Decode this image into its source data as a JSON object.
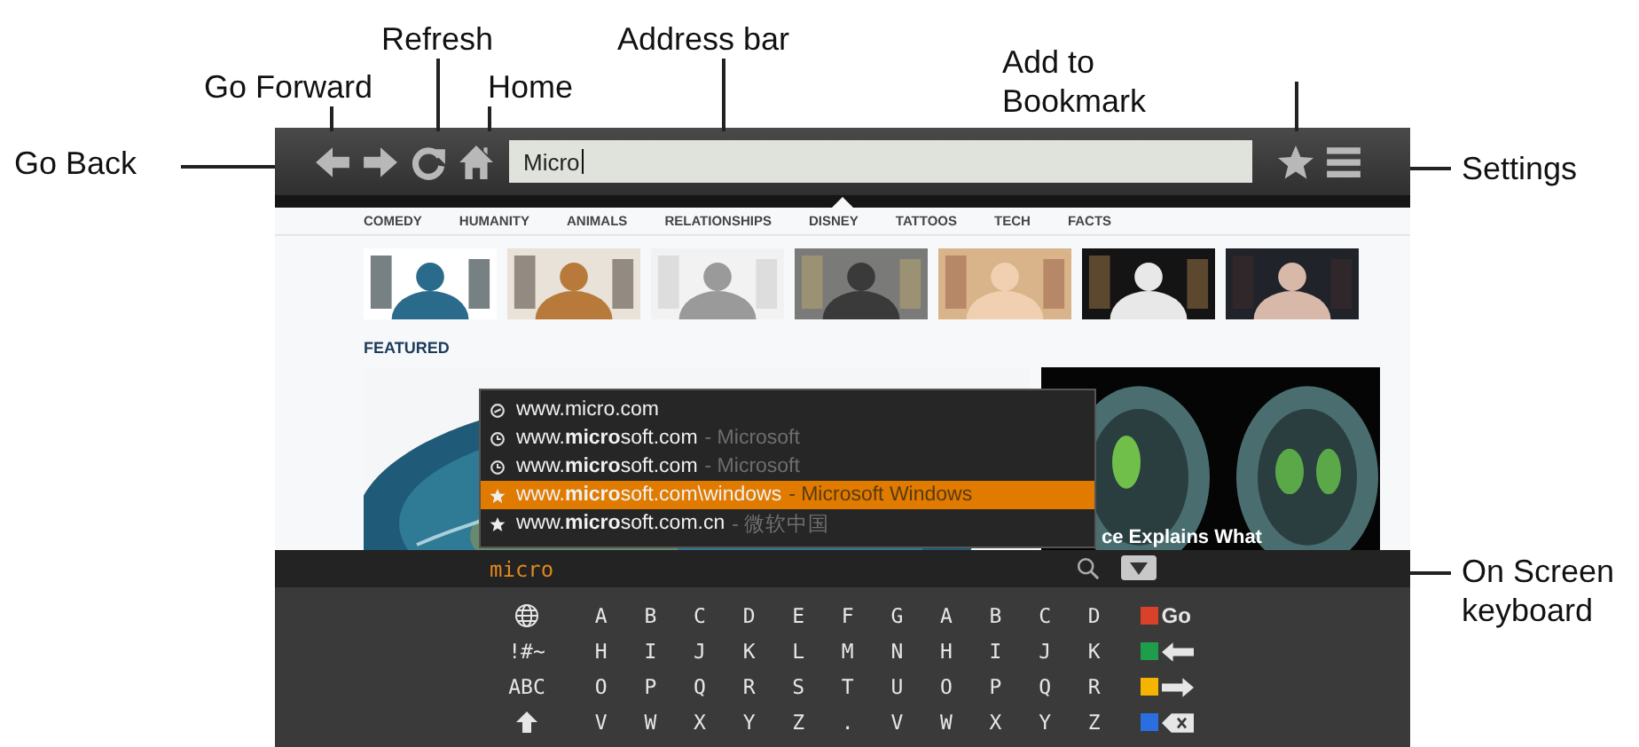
{
  "callouts": [
    {
      "text": "Go Back"
    },
    {
      "text": "Go Forward"
    },
    {
      "text": "Refresh"
    },
    {
      "text": "Home"
    },
    {
      "text": "Address bar"
    },
    {
      "text": "Add to Bookmark"
    },
    {
      "text": "Settings"
    },
    {
      "text": "On Screen keyboard"
    }
  ],
  "address_bar": {
    "value": "Micro"
  },
  "categories": [
    "COMEDY",
    "HUMANITY",
    "ANIMALS",
    "RELATIONSHIPS",
    "DISNEY",
    "TATTOOS",
    "TECH",
    "FACTS"
  ],
  "featured": {
    "heading": "FEATURED",
    "caption": "ce Explains What"
  },
  "suggestions": [
    {
      "kind": "link",
      "url": "www.micro.com",
      "selected": false
    },
    {
      "kind": "history",
      "url": "www.**micro**soft.com",
      "title": "- Microsoft",
      "selected": false
    },
    {
      "kind": "history",
      "url": "www.**micro**soft.com",
      "title": "- Microsoft",
      "selected": false
    },
    {
      "kind": "bookmark",
      "url": "www.**micro**soft.com\\windows",
      "title": "- Microsoft Windows",
      "selected": true
    },
    {
      "kind": "bookmark",
      "url": "www.**micro**soft.com.cn",
      "title": "- 微软中国",
      "selected": false
    }
  ],
  "keyboard": {
    "input": "micro",
    "rows": [
      {
        "mode": {
          "kind": "globe"
        },
        "keys": [
          "A",
          "B",
          "C",
          "D",
          "E",
          "F",
          "G",
          "A",
          "B",
          "C",
          "D"
        ],
        "action": {
          "kind": "text",
          "label": "Go",
          "color": "#d9412b"
        }
      },
      {
        "mode": {
          "kind": "text",
          "label": "!#~"
        },
        "keys": [
          "H",
          "I",
          "J",
          "K",
          "L",
          "M",
          "N",
          "H",
          "I",
          "J",
          "K"
        ],
        "action": {
          "kind": "left-arrow",
          "color": "#1e9e4a"
        }
      },
      {
        "mode": {
          "kind": "text",
          "label": "ABC"
        },
        "keys": [
          "O",
          "P",
          "Q",
          "R",
          "S",
          "T",
          "U",
          "O",
          "P",
          "Q",
          "R"
        ],
        "action": {
          "kind": "right-arrow",
          "color": "#f4b400"
        }
      },
      {
        "mode": {
          "kind": "shift"
        },
        "keys": [
          "V",
          "W",
          "X",
          "Y",
          "Z",
          ".",
          "V",
          "W",
          "X",
          "Y",
          "Z"
        ],
        "action": {
          "kind": "backspace",
          "color": "#2a6fe0"
        }
      }
    ]
  }
}
